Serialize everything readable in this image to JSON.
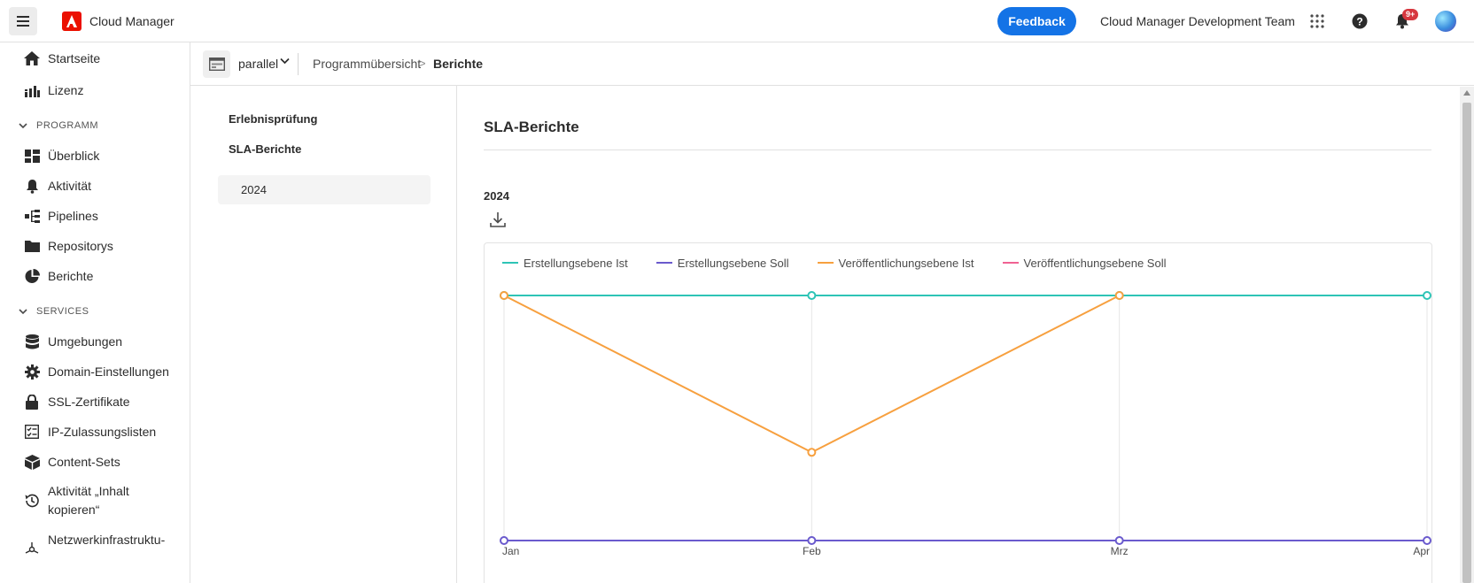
{
  "topbar": {
    "app_title": "Cloud Manager",
    "feedback_label": "Feedback",
    "team_name": "Cloud Manager Development Team",
    "notification_count": "9+"
  },
  "sidebar": {
    "items_top": [
      {
        "label": "Startseite",
        "icon": "home-icon"
      },
      {
        "label": "Lizenz",
        "icon": "license-icon"
      }
    ],
    "section_program": "PROGRAMM",
    "items_program": [
      {
        "label": "Überblick",
        "icon": "dashboard-icon"
      },
      {
        "label": "Aktivität",
        "icon": "bell-icon"
      },
      {
        "label": "Pipelines",
        "icon": "pipeline-icon"
      },
      {
        "label": "Repositorys",
        "icon": "folder-icon"
      },
      {
        "label": "Berichte",
        "icon": "pie-chart-icon"
      }
    ],
    "section_services": "SERVICES",
    "items_services": [
      {
        "label": "Umgebungen",
        "icon": "database-icon"
      },
      {
        "label": "Domain-Einstellungen",
        "icon": "gear-icon"
      },
      {
        "label": "SSL-Zertifikate",
        "icon": "lock-icon"
      },
      {
        "label": "IP-Zulassungslisten",
        "icon": "checklist-icon"
      },
      {
        "label": "Content-Sets",
        "icon": "box-icon"
      },
      {
        "label": "Aktivität „Inhalt kopieren“",
        "icon": "history-icon"
      },
      {
        "label": "Netzwerkinfrastruktu-",
        "icon": "network-icon"
      }
    ]
  },
  "breadcrumb": {
    "program": "parallel",
    "crumb1": "Programmübersicht",
    "separator": ">",
    "crumb2": "Berichte"
  },
  "subnav": {
    "item1": "Erlebnisprüfung",
    "item2": "SLA-Berichte",
    "year": "2024"
  },
  "main": {
    "title": "SLA-Berichte",
    "year_label": "2024"
  },
  "colors": {
    "teal": "#2ec4b6",
    "purple": "#6a5acd",
    "orange": "#f7a03f",
    "pink": "#f06292",
    "accent": "#1473e6"
  },
  "chart_data": {
    "type": "line",
    "categories": [
      "Jan",
      "Feb",
      "Mrz",
      "Apr"
    ],
    "series": [
      {
        "name": "Erstellungsebene Ist",
        "color": "#2ec4b6",
        "values": [
          100,
          100,
          100,
          100
        ]
      },
      {
        "name": "Erstellungsebene Soll",
        "color": "#6a5acd",
        "values": [
          0,
          0,
          0,
          0
        ]
      },
      {
        "name": "Veröffentlichungsebene Ist",
        "color": "#f7a03f",
        "values": [
          100,
          36,
          100,
          null
        ]
      },
      {
        "name": "Veröffentlichungsebene Soll",
        "color": "#f06292",
        "values": [
          null,
          null,
          null,
          null
        ]
      }
    ],
    "ylim": [
      0,
      100
    ],
    "grid": "vertical",
    "legend": "top-left"
  }
}
